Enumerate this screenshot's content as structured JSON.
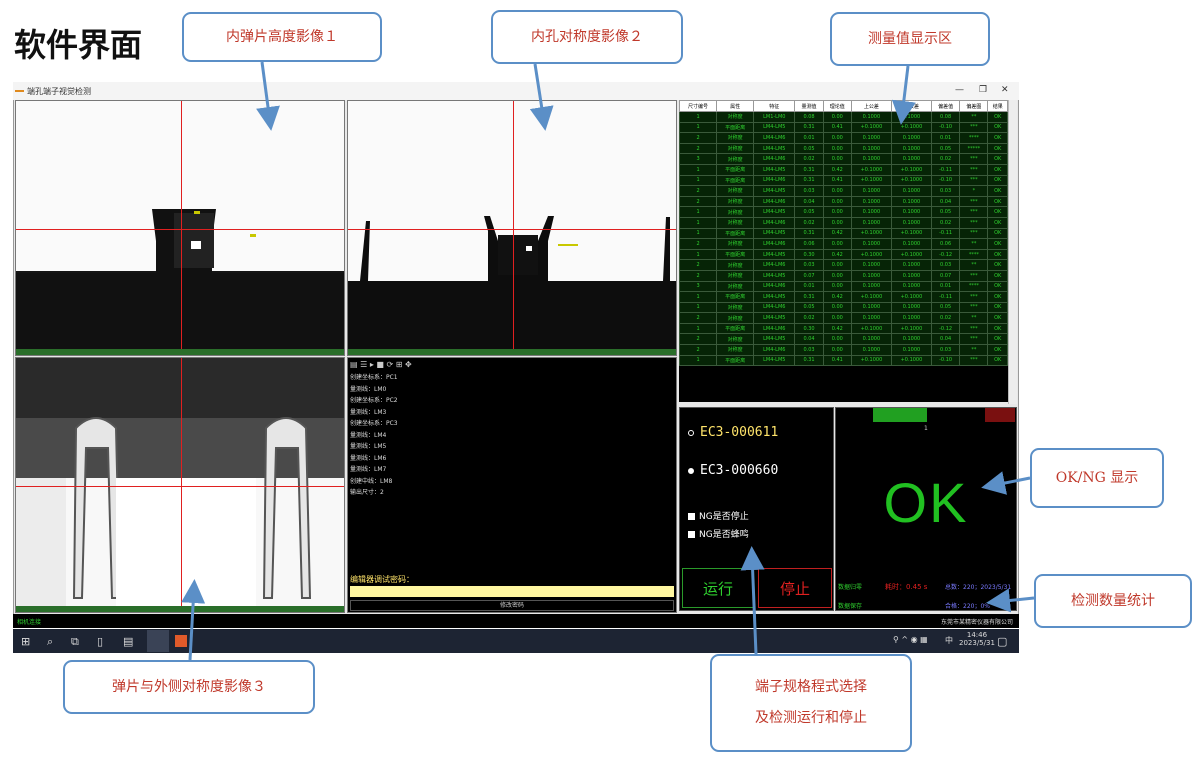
{
  "slide": {
    "title": "软件界面"
  },
  "callouts": {
    "c1": "内弹片高度影像１",
    "c2": "内孔对称度影像２",
    "c3": "测量值显示区",
    "c4": "OK/NG 显示",
    "c5": "检测数量统计",
    "c6": "弹片与外侧对称度影像３",
    "c7a": "端子规格程式选择",
    "c7b": "及检测运行和停止"
  },
  "window": {
    "title": "端孔端子视觉检测",
    "min": "—",
    "max": "❐",
    "close": "✕"
  },
  "table": {
    "headers": [
      "尺寸编号",
      "属性",
      "特征",
      "量测值",
      "理论值",
      "上公差",
      "下公差",
      "偏差值",
      "偏差图",
      "结果"
    ],
    "rows": [
      [
        "1",
        "对称度",
        "LM1-LM0",
        "0.08",
        "0.00",
        "0.1000",
        "0.1000",
        "0.08",
        "**",
        "OK"
      ],
      [
        "1",
        "平面距离",
        "LM4-LM5",
        "0.31",
        "0.41",
        "+0.1000",
        "+0.1000",
        "-0.10",
        "***",
        "OK"
      ],
      [
        "2",
        "对称度",
        "LM4-LM6",
        "0.01",
        "0.00",
        "0.1000",
        "0.1000",
        "0.01",
        "****",
        "OK"
      ],
      [
        "2",
        "对称度",
        "LM4-LM5",
        "0.05",
        "0.00",
        "0.1000",
        "0.1000",
        "0.05",
        "*****",
        "OK"
      ],
      [
        "3",
        "对称度",
        "LM4-LM6",
        "0.02",
        "0.00",
        "0.1000",
        "0.1000",
        "0.02",
        "***",
        "OK"
      ],
      [
        "1",
        "平面距离",
        "LM4-LM5",
        "0.31",
        "0.42",
        "+0.1000",
        "+0.1000",
        "-0.11",
        "***",
        "OK"
      ],
      [
        "1",
        "平面距离",
        "LM4-LM6",
        "0.31",
        "0.41",
        "+0.1000",
        "+0.1000",
        "-0.10",
        "***",
        "OK"
      ],
      [
        "2",
        "对称度",
        "LM4-LM5",
        "0.03",
        "0.00",
        "0.1000",
        "0.1000",
        "0.03",
        "*",
        "OK"
      ],
      [
        "2",
        "对称度",
        "LM4-LM6",
        "0.04",
        "0.00",
        "0.1000",
        "0.1000",
        "0.04",
        "***",
        "OK"
      ],
      [
        "1",
        "对称度",
        "LM4-LM5",
        "0.05",
        "0.00",
        "0.1000",
        "0.1000",
        "0.05",
        "***",
        "OK"
      ],
      [
        "1",
        "对称度",
        "LM4-LM6",
        "0.02",
        "0.00",
        "0.1000",
        "0.1000",
        "0.02",
        "***",
        "OK"
      ],
      [
        "1",
        "平面距离",
        "LM4-LM5",
        "0.31",
        "0.42",
        "+0.1000",
        "+0.1000",
        "-0.11",
        "***",
        "OK"
      ],
      [
        "2",
        "对称度",
        "LM4-LM6",
        "0.06",
        "0.00",
        "0.1000",
        "0.1000",
        "0.06",
        "**",
        "OK"
      ],
      [
        "1",
        "平面距离",
        "LM4-LM5",
        "0.30",
        "0.42",
        "+0.1000",
        "+0.1000",
        "-0.12",
        "****",
        "OK"
      ],
      [
        "2",
        "对称度",
        "LM4-LM6",
        "0.03",
        "0.00",
        "0.1000",
        "0.1000",
        "0.03",
        "**",
        "OK"
      ],
      [
        "2",
        "对称度",
        "LM4-LM5",
        "0.07",
        "0.00",
        "0.1000",
        "0.1000",
        "0.07",
        "***",
        "OK"
      ],
      [
        "3",
        "对称度",
        "LM4-LM6",
        "0.01",
        "0.00",
        "0.1000",
        "0.1000",
        "0.01",
        "****",
        "OK"
      ],
      [
        "1",
        "平面距离",
        "LM4-LM5",
        "0.31",
        "0.42",
        "+0.1000",
        "+0.1000",
        "-0.11",
        "***",
        "OK"
      ],
      [
        "1",
        "对称度",
        "LM4-LM6",
        "0.05",
        "0.00",
        "0.1000",
        "0.1000",
        "0.05",
        "***",
        "OK"
      ],
      [
        "2",
        "对称度",
        "LM4-LM5",
        "0.02",
        "0.00",
        "0.1000",
        "0.1000",
        "0.02",
        "**",
        "OK"
      ],
      [
        "1",
        "平面距离",
        "LM4-LM6",
        "0.30",
        "0.42",
        "+0.1000",
        "+0.1000",
        "-0.12",
        "***",
        "OK"
      ],
      [
        "2",
        "对称度",
        "LM4-LM5",
        "0.04",
        "0.00",
        "0.1000",
        "0.1000",
        "0.04",
        "***",
        "OK"
      ],
      [
        "2",
        "对称度",
        "LM4-LM6",
        "0.03",
        "0.00",
        "0.1000",
        "0.1000",
        "0.03",
        "**",
        "OK"
      ],
      [
        "1",
        "平面距离",
        "LM4-LM5",
        "0.31",
        "0.41",
        "+0.1000",
        "+0.1000",
        "-0.10",
        "***",
        "OK"
      ]
    ]
  },
  "tree": {
    "items": [
      "创建坐标系：PC1",
      "量测线：LM0",
      "创建坐标系：PC2",
      "量测线：LM3",
      "创建坐标系：PC3",
      "量测线：LM4",
      "量测线：LM5",
      "量测线：LM6",
      "量测线：LM7",
      "创建中线：LM8",
      "输出尺寸：2"
    ],
    "edit_label": "编辑器调试密码：",
    "unlock_label": "修改密码"
  },
  "control": {
    "prog1": "EC3-000611",
    "prog2": "EC3-000660",
    "chk1": "NG是否停止",
    "chk2": "NG是否蜂鸣",
    "run": "运行",
    "stop": "停止"
  },
  "result": {
    "ok": "OK",
    "reset1": "数据归零",
    "reset2": "数据保存",
    "time": "耗时：0.45 s",
    "count1": "总数：220；2023/5/31",
    "count2": "合格：220；0%",
    "dot": "1"
  },
  "status": {
    "left": "相机连接",
    "right": "东莞市某精密仪器有限公司"
  },
  "taskbar": {
    "time": "14:46",
    "date": "2023/5/31",
    "ime": "中"
  }
}
